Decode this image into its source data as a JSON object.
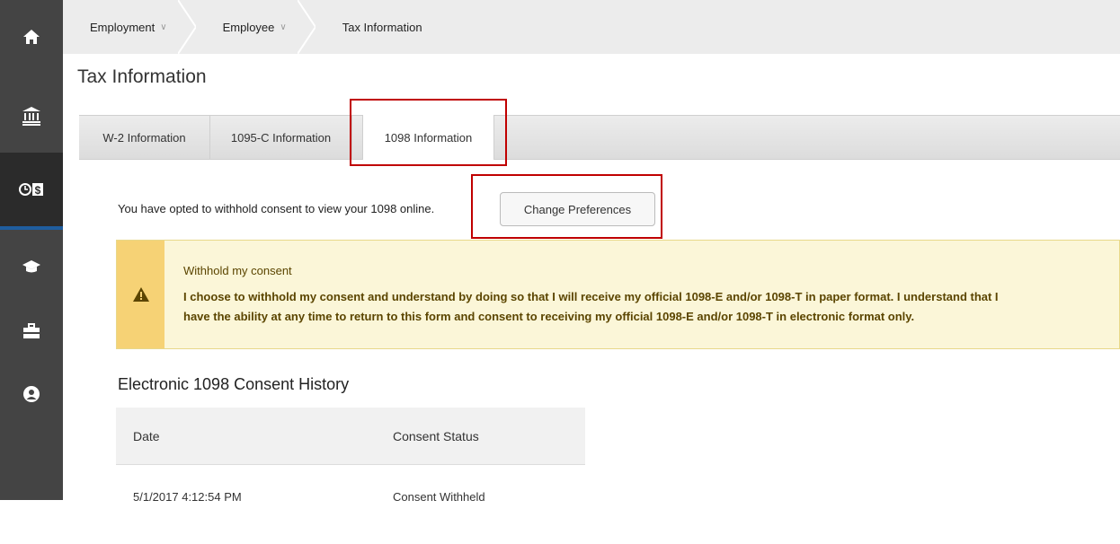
{
  "nav_rail": {
    "items": [
      {
        "icon": "home-icon"
      },
      {
        "icon": "bank-icon"
      },
      {
        "icon": "time-money-icon",
        "active": true
      },
      {
        "icon": "graduation-cap-icon"
      },
      {
        "icon": "briefcase-icon"
      },
      {
        "icon": "user-circle-icon"
      }
    ],
    "active_color": "#1f5d9e"
  },
  "breadcrumb": {
    "items": [
      {
        "label": "Employment",
        "has_dropdown": true
      },
      {
        "label": "Employee",
        "has_dropdown": true
      },
      {
        "label": "Tax Information",
        "has_dropdown": false
      }
    ]
  },
  "page": {
    "title": "Tax Information"
  },
  "tabs": [
    {
      "label": "W-2 Information",
      "active": false
    },
    {
      "label": "1095-C Information",
      "active": false
    },
    {
      "label": "1098 Information",
      "active": true
    }
  ],
  "consent": {
    "message": "You have opted to withhold consent to view your 1098 online.",
    "button_label": "Change Preferences"
  },
  "alert": {
    "heading": "Withhold my consent",
    "body_line1": "I choose to withhold my consent and understand by doing so that I will receive my official 1098-E and/or 1098-T in paper format. I understand that I",
    "body_line2": "have the ability at any time to return to this form and consent to receiving my official 1098-E and/or 1098-T in electronic format only.",
    "icon": "warning-icon",
    "color": "#f6d275"
  },
  "history": {
    "title": "Electronic 1098 Consent History",
    "columns": [
      "Date",
      "Consent Status"
    ],
    "rows": [
      [
        "5/1/2017 4:12:54 PM",
        "Consent Withheld"
      ]
    ]
  },
  "annotation_color": "#c00000"
}
